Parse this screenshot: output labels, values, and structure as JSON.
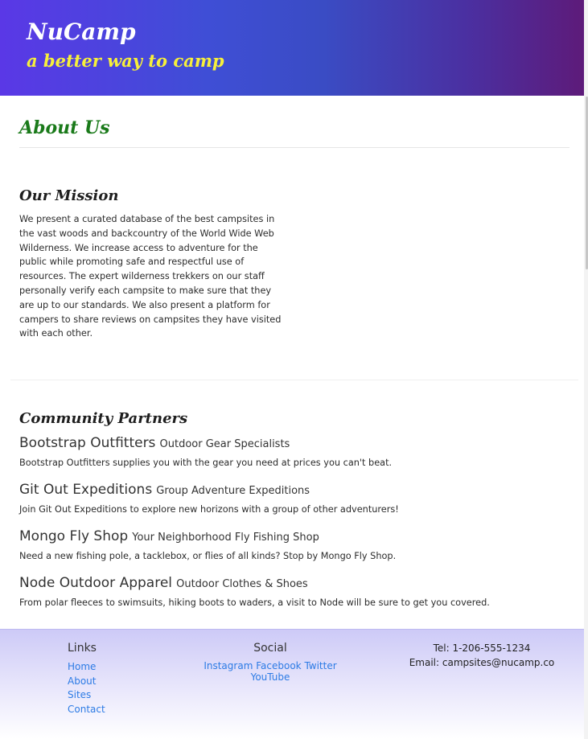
{
  "header": {
    "brand": "NuCamp",
    "tagline": "a better way to camp"
  },
  "page": {
    "title": "About Us"
  },
  "mission": {
    "heading": "Our Mission",
    "text": "We present a curated database of the best campsites in the vast woods and backcountry of the World Wide Web Wilderness. We increase access to adventure for the public while promoting safe and respectful use of resources. The expert wilderness trekkers on our staff personally verify each campsite to make sure that they are up to our standards. We also present a platform for campers to share reviews on campsites they have visited with each other."
  },
  "partners": {
    "heading": "Community Partners",
    "items": [
      {
        "name": "Bootstrap Outfitters",
        "subtitle": "Outdoor Gear Specialists",
        "description": "Bootstrap Outfitters supplies you with the gear you need at prices you can't beat."
      },
      {
        "name": "Git Out Expeditions",
        "subtitle": "Group Adventure Expeditions",
        "description": "Join Git Out Expeditions to explore new horizons with a group of other adventurers!"
      },
      {
        "name": "Mongo Fly Shop",
        "subtitle": "Your Neighborhood Fly Fishing Shop",
        "description": "Need a new fishing pole, a tacklebox, or flies of all kinds? Stop by Mongo Fly Shop."
      },
      {
        "name": "Node Outdoor Apparel",
        "subtitle": "Outdoor Clothes & Shoes",
        "description": "From polar fleeces to swimsuits, hiking boots to waders, a visit to Node will be sure to get you covered."
      }
    ]
  },
  "footer": {
    "links": {
      "title": "Links",
      "items": [
        "Home",
        "About",
        "Sites",
        "Contact"
      ]
    },
    "social": {
      "title": "Social",
      "items": [
        "Instagram",
        "Facebook",
        "Twitter",
        "YouTube"
      ]
    },
    "contact": {
      "tel": "Tel: 1-206-555-1234",
      "email": "Email: campsites@nucamp.co"
    }
  }
}
